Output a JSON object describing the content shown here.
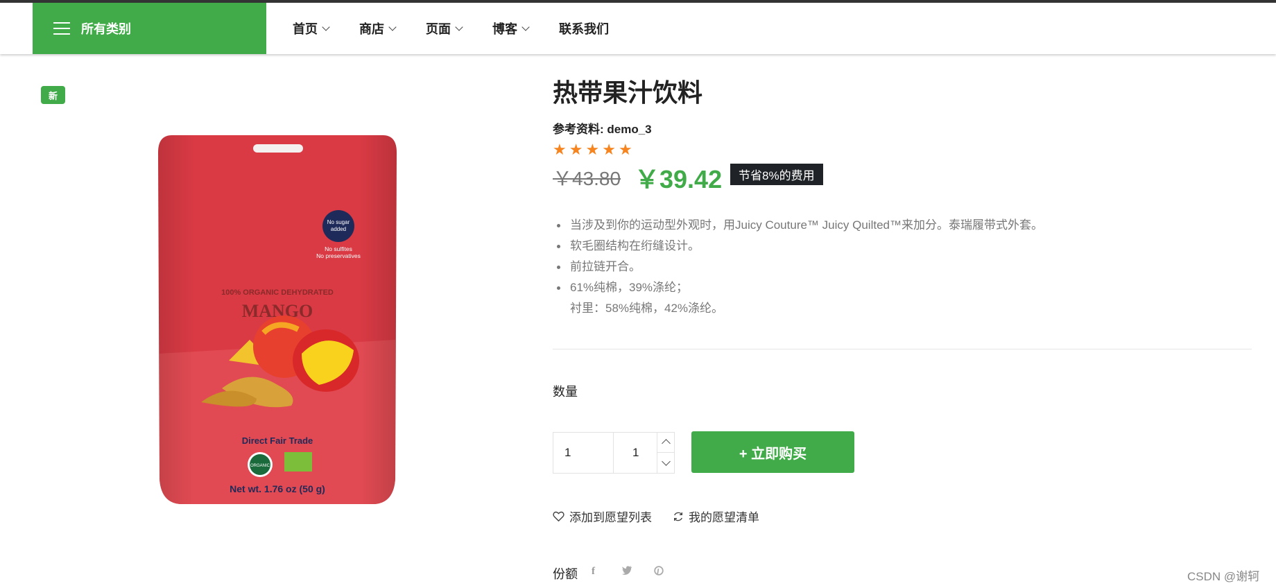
{
  "nav": {
    "all_categories": "所有类别",
    "menu": [
      {
        "label": "首页",
        "dropdown": true
      },
      {
        "label": "商店",
        "dropdown": true
      },
      {
        "label": "页面",
        "dropdown": true
      },
      {
        "label": "博客",
        "dropdown": true
      },
      {
        "label": "联系我们",
        "dropdown": false
      }
    ]
  },
  "product": {
    "badge": "新",
    "image": {
      "no_sugar": "No sugar",
      "added": "added",
      "no_sulfites": "No sulfites",
      "no_preservatives": "No preservatives",
      "subtitle": "100% ORGANIC DEHYDRATED",
      "name": "MANGO",
      "trade": "Direct Fair Trade",
      "organic": "ORGANIC",
      "weight": "Net wt. 1.76 oz (50 g)"
    },
    "title": "热带果汁饮料",
    "reference": "参考资料: demo_3",
    "rating": 5,
    "price_old": "￥43.80",
    "price_new": "￥39.42",
    "save": "节省8%的费用",
    "features": [
      "当涉及到你的运动型外观时，用Juicy Couture™ Juicy Quilted™来加分。泰瑞履带式外套。",
      "软毛圈结构在绗缝设计。",
      "前拉链开合。",
      "61%纯棉，39%涤纶；"
    ],
    "feature_line2": "衬里：58%纯棉，42%涤纶。",
    "quantity_label": "数量",
    "quantity_value_1": "1",
    "quantity_value_2": "1",
    "buy_button": "+ 立即购买",
    "add_wishlist": "添加到愿望列表",
    "my_wishlist": "我的愿望清单",
    "share_label": "份额",
    "social": [
      "f",
      "t",
      "p"
    ]
  },
  "watermark": "CSDN @谢轲",
  "colors": {
    "brand_green": "#40ab48",
    "star_orange": "#f6841f",
    "dark_badge": "#1f2327",
    "pack_red": "#d93a44"
  },
  "icons": [
    "menu-icon",
    "chevron-down-icon",
    "star-icon",
    "heart-icon",
    "refresh-icon",
    "facebook-icon",
    "twitter-icon",
    "pinterest-icon"
  ]
}
